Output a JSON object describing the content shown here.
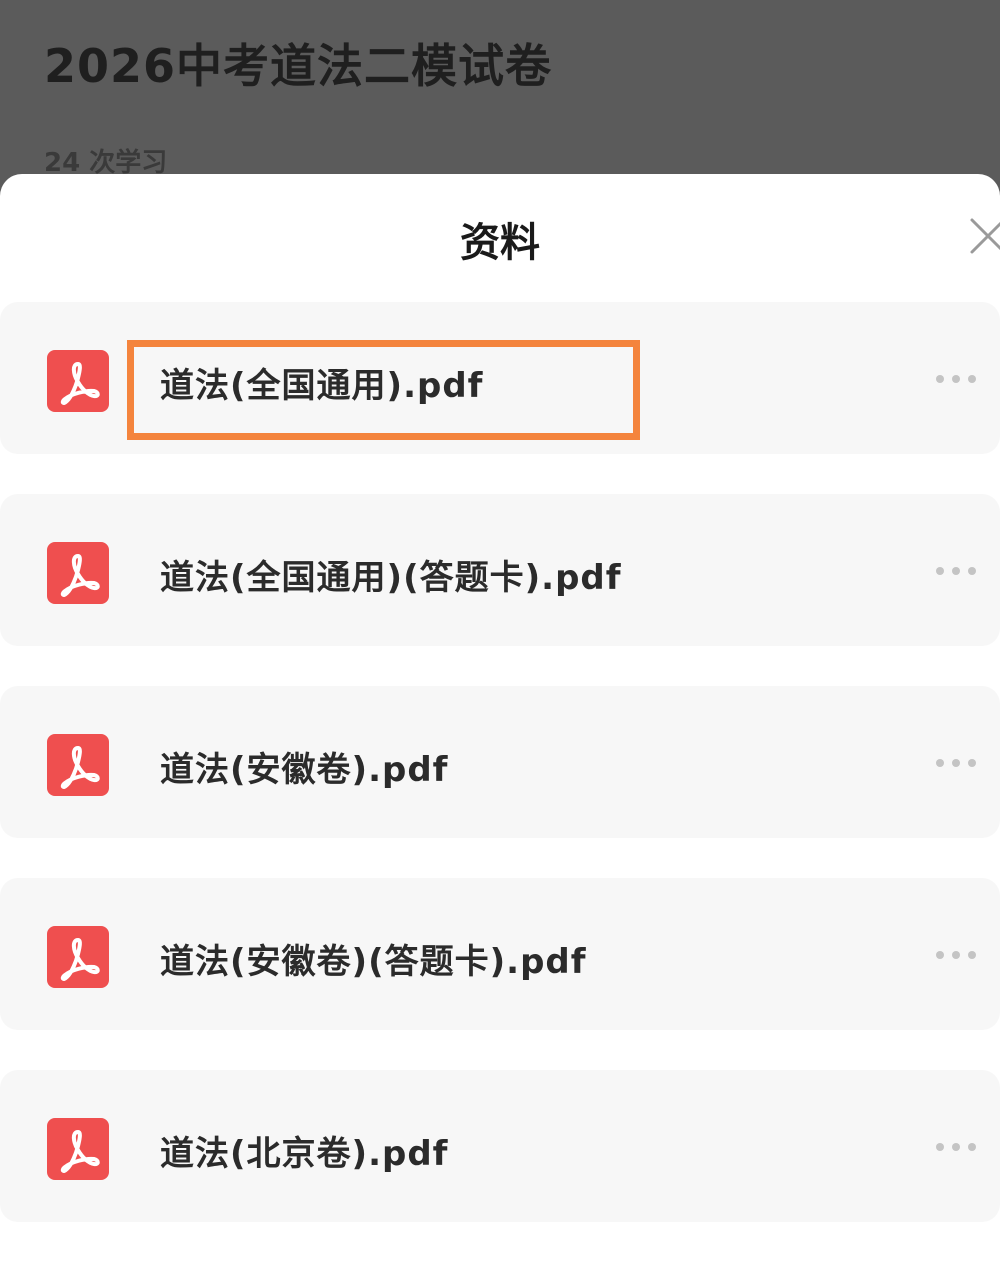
{
  "background": {
    "title": "2026中考道法二模试卷",
    "study_count": "24 次学习"
  },
  "sheet": {
    "title": "资料",
    "close_icon": "close-icon"
  },
  "files": [
    {
      "name": "道法(全国通用).pdf",
      "icon": "pdf-icon",
      "highlighted": true
    },
    {
      "name": "道法(全国通用)(答题卡).pdf",
      "icon": "pdf-icon",
      "highlighted": false
    },
    {
      "name": "道法(安徽卷).pdf",
      "icon": "pdf-icon",
      "highlighted": false
    },
    {
      "name": "道法(安徽卷)(答题卡).pdf",
      "icon": "pdf-icon",
      "highlighted": false
    },
    {
      "name": "道法(北京卷).pdf",
      "icon": "pdf-icon",
      "highlighted": false
    }
  ],
  "colors": {
    "pdf_icon": "#ef4f4f",
    "highlight": "#f4843d",
    "card_bg": "#f7f7f7",
    "dim_overlay": "#5b5b5b"
  }
}
